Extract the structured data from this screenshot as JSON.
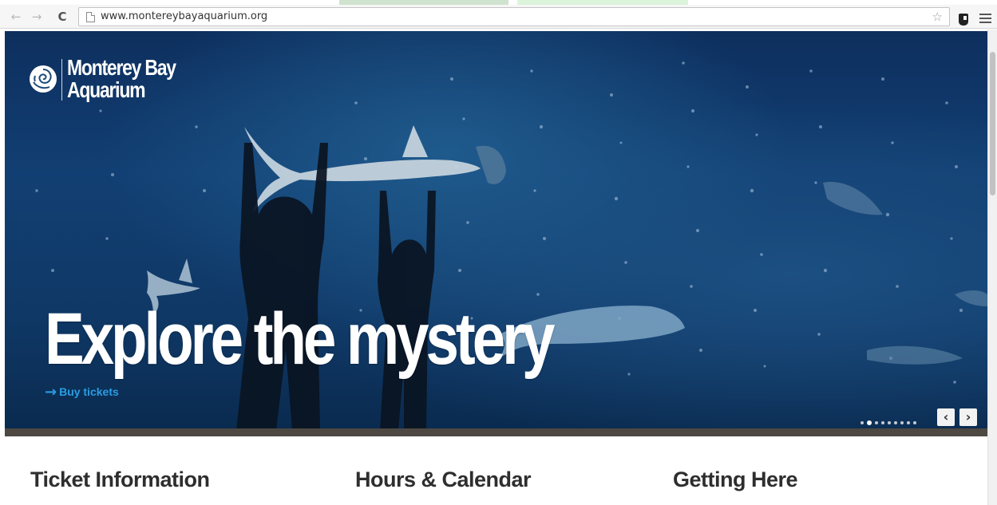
{
  "browser": {
    "url": "www.montereybayaquarium.org",
    "back_glyph": "←",
    "forward_glyph": "→",
    "reload_glyph": "C",
    "bookmark_glyph": "☆"
  },
  "site": {
    "logo_line1": "Monterey Bay",
    "logo_line2": "Aquarium"
  },
  "hero": {
    "headline": "Explore the mystery",
    "cta_arrow": "→",
    "cta_label": "Buy tickets",
    "slide_count": 9,
    "active_slide": 2,
    "prev_glyph": "‹",
    "next_glyph": "›"
  },
  "sections": {
    "ticket_info": "Ticket Information",
    "hours": "Hours & Calendar",
    "getting_here": "Getting Here"
  },
  "colors": {
    "link_blue": "#2a9de2",
    "ocean_deep": "#0d2f5e",
    "heading_text": "#2e2e2e"
  },
  "icons": {
    "logo": "aquarium-logo-icon",
    "page": "page-icon",
    "star": "bookmark-star-icon",
    "extension": "extension-icon",
    "menu": "menu-icon"
  }
}
